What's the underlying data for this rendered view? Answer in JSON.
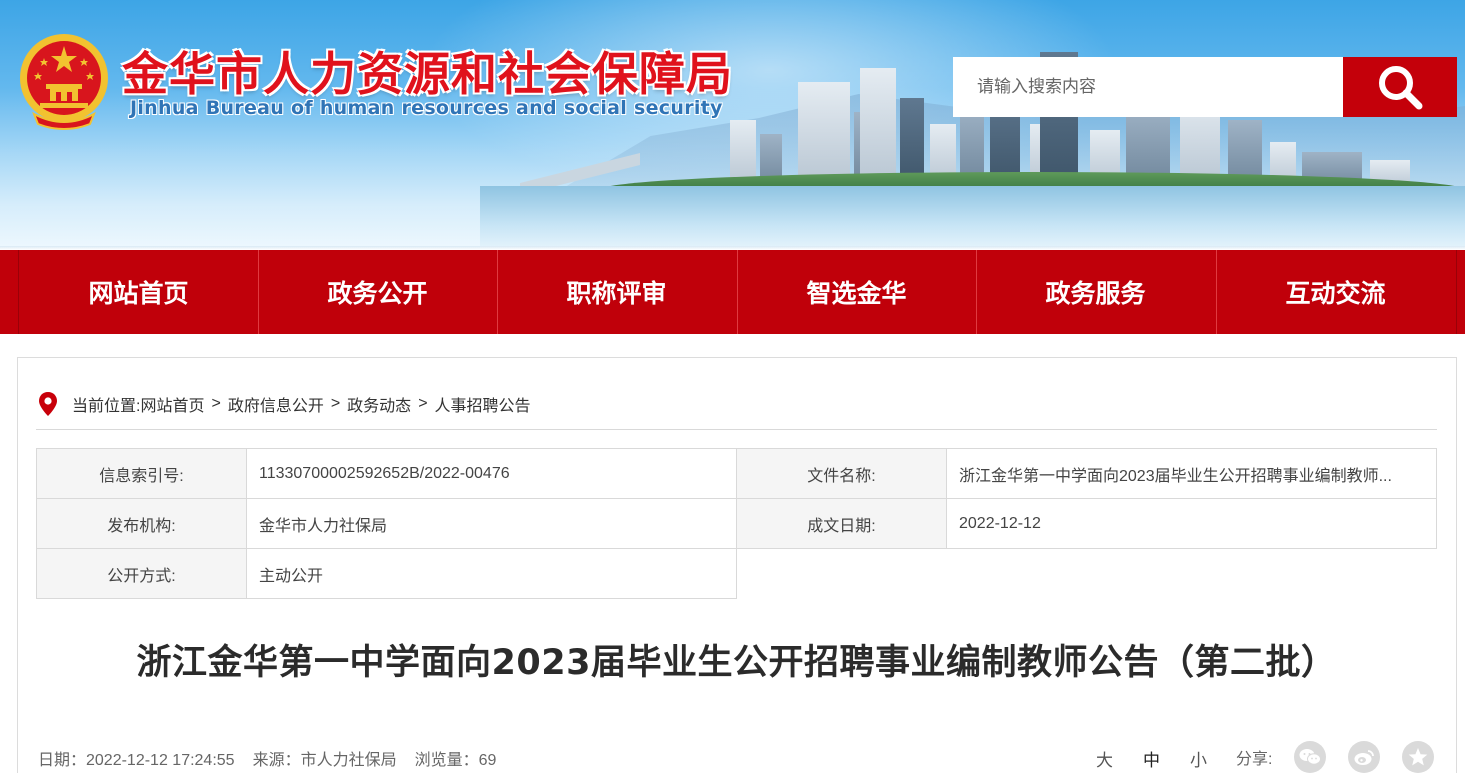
{
  "header": {
    "title_cn": "金华市人力资源和社会保障局",
    "title_en": "Jinhua Bureau of human resources and social security",
    "search": {
      "placeholder": "请输入搜索内容"
    },
    "colors": {
      "brand_red": "#c0000a",
      "title_red": "#e0121c",
      "title_blue": "#2f74b6"
    }
  },
  "nav": {
    "items": [
      {
        "label": "网站首页"
      },
      {
        "label": "政务公开"
      },
      {
        "label": "职称评审"
      },
      {
        "label": "智选金华"
      },
      {
        "label": "政务服务"
      },
      {
        "label": "互动交流"
      }
    ]
  },
  "breadcrumb": {
    "prefix": "当前位置:",
    "items": [
      "网站首页",
      "政府信息公开",
      "政务动态",
      "人事招聘公告"
    ],
    "separator": ">"
  },
  "meta": {
    "index_label": "信息索引号:",
    "index_value": "11330700002592652B/2022-00476",
    "filename_label": "文件名称:",
    "filename_value": "浙江金华第一中学面向2023届毕业生公开招聘事业编制教师...",
    "publisher_label": "发布机构:",
    "publisher_value": "金华市人力社保局",
    "date_label": "成文日期:",
    "date_value": "2022-12-12",
    "method_label": "公开方式:",
    "method_value": "主动公开"
  },
  "article": {
    "title": "浙江金华第一中学面向2023届毕业生公开招聘事业编制教师公告（第二批）",
    "date": "日期：2022-12-12 17:24:55",
    "source": "来源：市人力社保局",
    "views": "浏览量：69",
    "font_sizes": [
      "大",
      "中",
      "小"
    ],
    "share_label": "分享:",
    "share_icons": [
      "wechat-icon",
      "weibo-icon",
      "qzone-icon"
    ]
  }
}
